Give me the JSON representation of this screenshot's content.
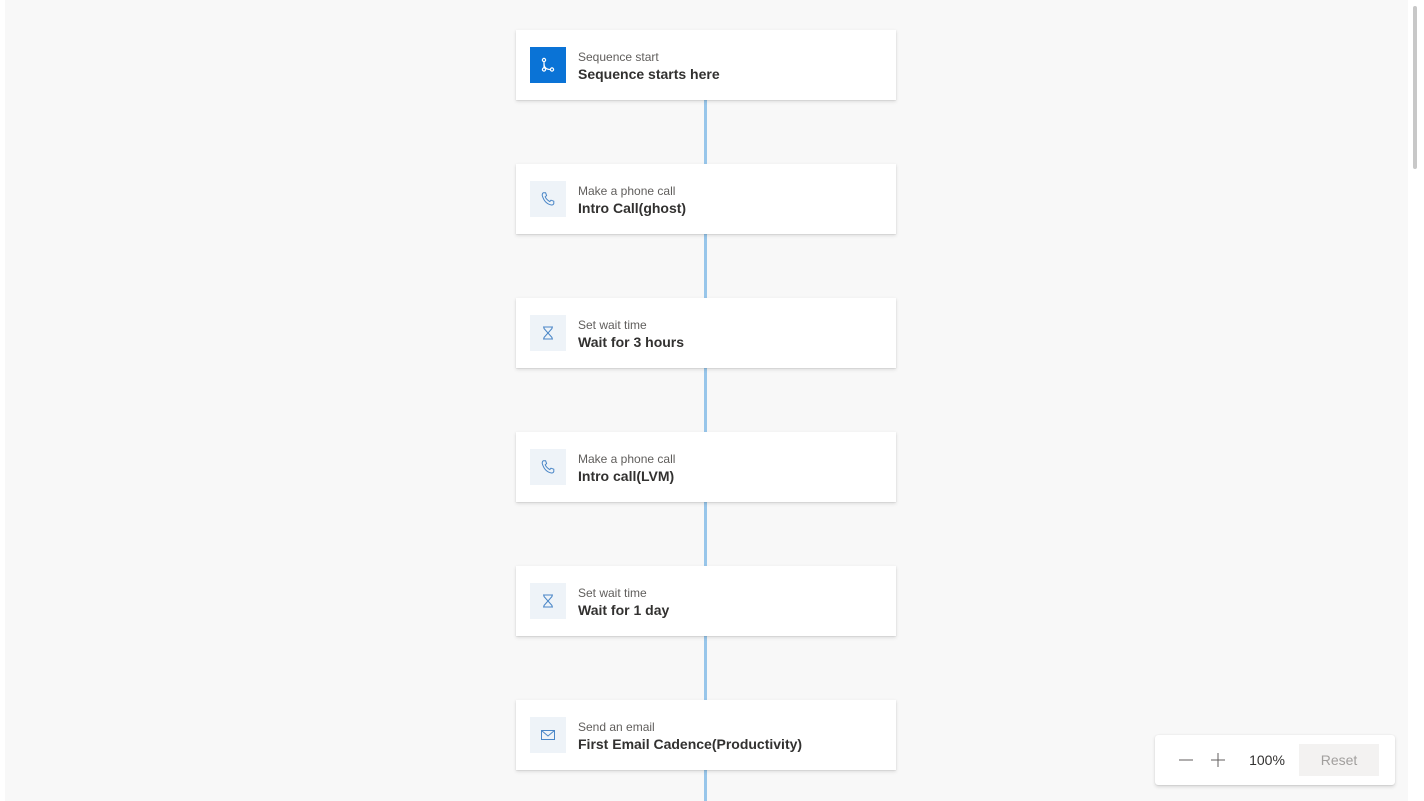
{
  "steps": [
    {
      "type": "Sequence start",
      "title": "Sequence starts here",
      "icon": "sequence-start-icon"
    },
    {
      "type": "Make a phone call",
      "title": "Intro Call(ghost)",
      "icon": "phone-icon"
    },
    {
      "type": "Set wait time",
      "title": "Wait for 3 hours",
      "icon": "hourglass-icon"
    },
    {
      "type": "Make a phone call",
      "title": "Intro call(LVM)",
      "icon": "phone-icon"
    },
    {
      "type": "Set wait time",
      "title": "Wait for 1 day",
      "icon": "hourglass-icon"
    },
    {
      "type": "Send an email",
      "title": "First Email Cadence(Productivity)",
      "icon": "mail-icon"
    }
  ],
  "zoom": {
    "level": "100%",
    "reset_label": "Reset"
  },
  "colors": {
    "accent": "#0a73d6",
    "connector": "#98c6ea",
    "canvas_bg": "#f8f8f8"
  }
}
